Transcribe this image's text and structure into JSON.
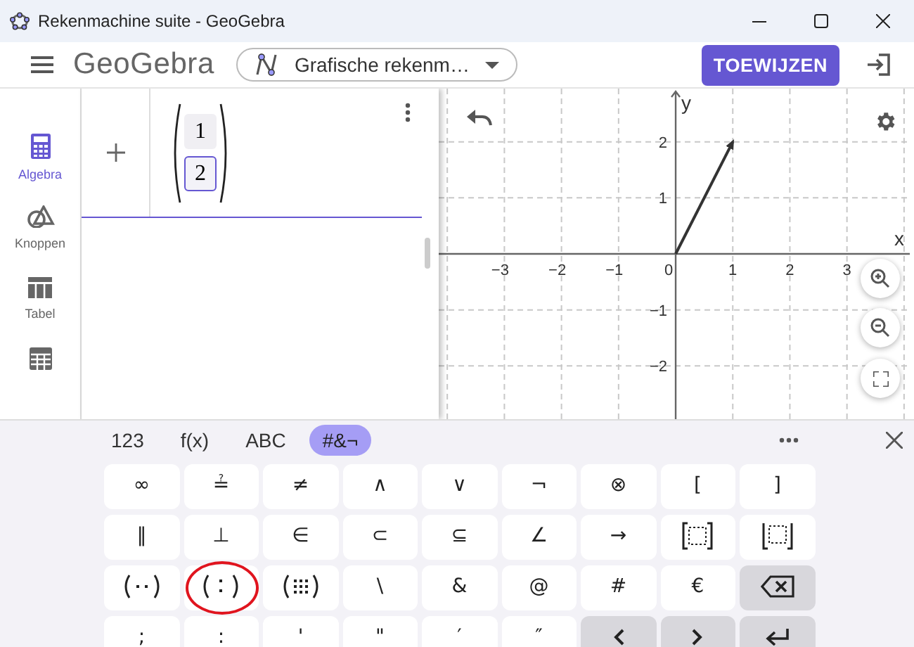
{
  "window": {
    "title": "Rekenmachine suite - GeoGebra"
  },
  "header": {
    "logo": "GeoGebra",
    "app_selector": "Grafische rekenm…",
    "assign_button": "TOEWIJZEN"
  },
  "sidebar": {
    "items": [
      {
        "kind": "calculator",
        "label": "Algebra",
        "selected": true
      },
      {
        "kind": "shapes",
        "label": "Knoppen",
        "selected": false
      },
      {
        "kind": "table",
        "label": "Tabel",
        "selected": false
      },
      {
        "kind": "spreadsheet",
        "selected": false
      }
    ]
  },
  "algebra": {
    "entries": [
      {
        "cells": [
          {
            "value": "1",
            "selected": false
          },
          {
            "value": "2",
            "selected": true
          }
        ]
      }
    ]
  },
  "graphics": {
    "chart_data": {
      "type": "line",
      "xlabel": "x",
      "ylabel": "y",
      "x": [
        0,
        1
      ],
      "series": [
        {
          "color": "#333333",
          "values": [
            0,
            2
          ]
        }
      ],
      "grid": true,
      "xlim": [
        -4.15,
        4.1
      ],
      "ylim": [
        -2.95,
        2.95
      ],
      "xticks": [
        -3,
        -2,
        -1,
        0,
        1,
        2,
        3
      ],
      "yticks": [
        -2,
        -1,
        1,
        2
      ]
    }
  },
  "keyboard": {
    "tabs": [
      {
        "label": "123",
        "selected": false
      },
      {
        "label": "f(x)",
        "selected": false
      },
      {
        "label": "ABC",
        "selected": false
      },
      {
        "label": "#&¬",
        "selected": true
      }
    ],
    "rows": [
      [
        {
          "kind": "key",
          "label": "∞",
          "highlighted": false
        },
        {
          "kind": "key",
          "label": "≟",
          "highlighted": false
        },
        {
          "kind": "key",
          "label": "≠",
          "highlighted": false
        },
        {
          "kind": "key",
          "label": "∧",
          "highlighted": false
        },
        {
          "kind": "key",
          "label": "∨",
          "highlighted": false
        },
        {
          "kind": "key",
          "label": "¬",
          "highlighted": false
        },
        {
          "kind": "key",
          "label": "⊗",
          "highlighted": false
        },
        {
          "kind": "key",
          "label": "[",
          "highlighted": false
        },
        {
          "kind": "key",
          "label": "]",
          "highlighted": false
        }
      ],
      [
        {
          "kind": "key",
          "label": "‖",
          "highlighted": false
        },
        {
          "kind": "key",
          "label": "⊥",
          "highlighted": false
        },
        {
          "kind": "key",
          "label": "∈",
          "highlighted": false
        },
        {
          "kind": "key",
          "label": "⊂",
          "highlighted": false
        },
        {
          "kind": "key",
          "label": "⊆",
          "highlighted": false
        },
        {
          "kind": "key",
          "label": "∠",
          "highlighted": false
        },
        {
          "kind": "key",
          "label": "→",
          "highlighted": false
        },
        {
          "kind": "bracketmatrix",
          "highlighted": false
        },
        {
          "kind": "cornermatrix",
          "highlighted": false
        }
      ],
      [
        {
          "kind": "point",
          "highlighted": false
        },
        {
          "kind": "vector",
          "highlighted": true
        },
        {
          "kind": "matrix",
          "highlighted": false
        },
        {
          "kind": "key",
          "label": "\\",
          "highlighted": false
        },
        {
          "kind": "key",
          "label": "&",
          "highlighted": false
        },
        {
          "kind": "key",
          "label": "@",
          "highlighted": false
        },
        {
          "kind": "key",
          "label": "#",
          "highlighted": false
        },
        {
          "kind": "key",
          "label": "€",
          "highlighted": false
        },
        {
          "kind": "backspace",
          "highlighted": false
        }
      ],
      [
        {
          "kind": "key",
          "label": ";",
          "highlighted": false
        },
        {
          "kind": "key",
          "label": ":",
          "highlighted": false
        },
        {
          "kind": "key",
          "label": "'",
          "highlighted": false
        },
        {
          "kind": "key",
          "label": "\"",
          "highlighted": false
        },
        {
          "kind": "key",
          "label": "′",
          "highlighted": false
        },
        {
          "kind": "key",
          "label": "″",
          "highlighted": false
        },
        {
          "kind": "left",
          "highlighted": false
        },
        {
          "kind": "right",
          "highlighted": false
        },
        {
          "kind": "enter",
          "highlighted": false
        }
      ]
    ]
  }
}
